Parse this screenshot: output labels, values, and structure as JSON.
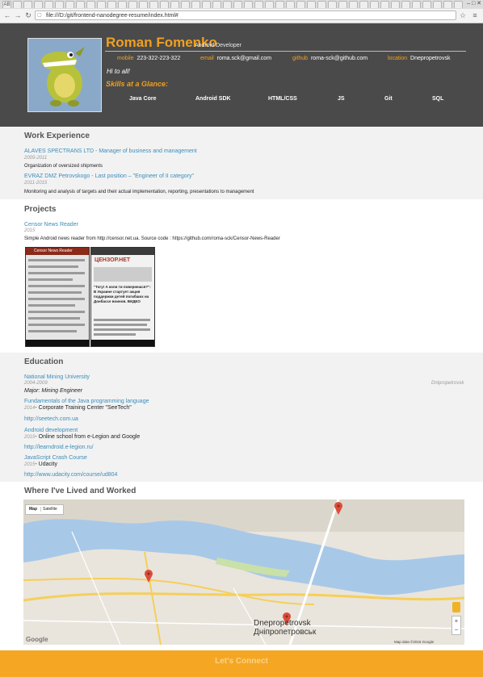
{
  "browser": {
    "tab_icons": [
      "AB",
      "",
      "",
      "",
      "",
      "",
      "",
      "",
      "",
      "",
      "",
      "",
      "",
      "",
      "",
      "",
      "",
      "",
      "",
      "",
      "",
      "",
      "",
      "",
      "",
      "",
      "",
      "",
      "",
      "",
      "",
      "",
      "",
      "",
      "",
      "",
      "",
      "",
      "",
      "",
      "",
      "",
      "",
      ""
    ],
    "url": "file:///D:/git/frontend-nanodegree-resume/index.html#",
    "window_controls": "– □ ✕"
  },
  "header": {
    "name": "Roman Fomenko",
    "role": "Android Developer",
    "contacts": [
      {
        "label": "mobile",
        "value": "223-322-223-322"
      },
      {
        "label": "email",
        "value": "roma.sck@gmail.com"
      },
      {
        "label": "github",
        "value": "roma-sck@github.com"
      },
      {
        "label": "location",
        "value": "Dnepropetrovsk"
      }
    ],
    "welcome": "Hi to all!",
    "skills_title": "Skills at a Glance:",
    "skills": [
      "Java Core",
      "Android SDK",
      "HTML/CSS",
      "JS",
      "Git",
      "SQL"
    ]
  },
  "work": {
    "title": "Work Experience",
    "jobs": [
      {
        "link": "ALAVES SPECTRANS LTD - Manager of business and management",
        "dates": "2009-2011",
        "description": "Organization of oversized shipments"
      },
      {
        "link": "EVRAZ DMZ Petrovskogo - Last position – \"Engineer of II category\"",
        "dates": "2011-2015",
        "description": "Monitoring and analysis of targets and their actual implementation, reporting, presentations to management"
      }
    ]
  },
  "projects": {
    "title": "Projects",
    "items": [
      {
        "link": "Censor News Reader",
        "dates": "2015",
        "description": "Simple Android news reader from http://censor.net.ua. Source code : https://github.com/roma-sck/Censor-News-Reader"
      }
    ],
    "shot1_header": "Censor News Reader",
    "shot2_logo": "ЦЕНЗОР.НЕТ",
    "shot2_headline": "\"Тогу! А коли ти повернешся?\": В Украине стартует акция поддержки детей погибших на Донбассе воинов. ВИДЕО"
  },
  "education": {
    "title": "Education",
    "school": {
      "link": "National Mining University",
      "dates": "2004-2009",
      "location": "Dnipropetrovsk",
      "major": "Major: Mining Engineer"
    },
    "courses": [
      {
        "link": "Fundamentals of the Java programming language",
        "dates": "2014",
        "school": "- Corporate Training Center \"SeeTech\"",
        "url": "http://seetech.com.ua"
      },
      {
        "link": "Android development",
        "dates": "2015",
        "school": "- Online school from e-Legion and Google",
        "url": "http://learndroid.e-legion.ru/"
      },
      {
        "link": "JavaScript Crash Course",
        "dates": "2015",
        "school": "- Udacity",
        "url": "http://www.udacity.com/course/ud804"
      }
    ]
  },
  "map": {
    "title": "Where I've Lived and Worked",
    "btn_map": "Map",
    "btn_satellite": "Satellite",
    "city_en": "Dnepropetrovsk",
    "city_ua": "Дніпропетровськ",
    "attribution": "Map data ©2015 Google",
    "google": "Google",
    "zoom_in": "+",
    "zoom_out": "−",
    "colors": {
      "water": "#a8c8e8",
      "land": "#e9e5dc",
      "road": "#f5cf5a",
      "marker": "#dd4b39"
    }
  },
  "footer": {
    "cta": "Let's Connect"
  }
}
